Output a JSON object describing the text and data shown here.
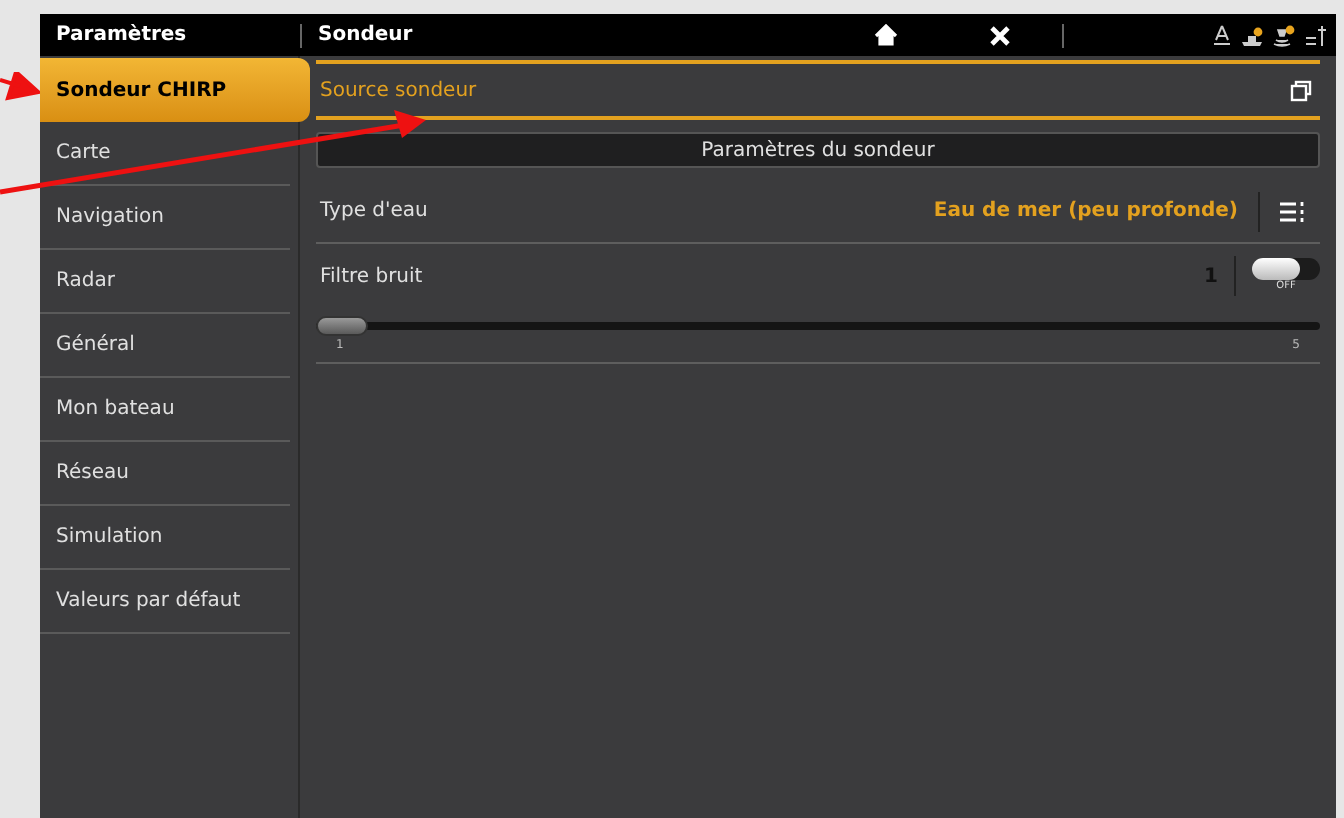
{
  "header": {
    "title": "Paramètres",
    "section": "Sondeur"
  },
  "sidebar": {
    "items": [
      {
        "label": "Sondeur CHIRP",
        "selected": true
      },
      {
        "label": "Carte",
        "selected": false
      },
      {
        "label": "Navigation",
        "selected": false
      },
      {
        "label": "Radar",
        "selected": false
      },
      {
        "label": "Général",
        "selected": false
      },
      {
        "label": "Mon bateau",
        "selected": false
      },
      {
        "label": "Réseau",
        "selected": false
      },
      {
        "label": "Simulation",
        "selected": false
      },
      {
        "label": "Valeurs par défaut",
        "selected": false
      }
    ]
  },
  "source": {
    "label": "Source sondeur"
  },
  "section_title": "Paramètres du sondeur",
  "settings": [
    {
      "kind": "choice",
      "label": "Type d'eau",
      "value": "Eau de mer (peu profonde)"
    },
    {
      "kind": "toggle",
      "label": "Filtre bruit",
      "value": "1",
      "on": false,
      "state_label": "OFF"
    },
    {
      "kind": "slider",
      "level": 0,
      "min_label": "1",
      "max_label": "5"
    }
  ]
}
